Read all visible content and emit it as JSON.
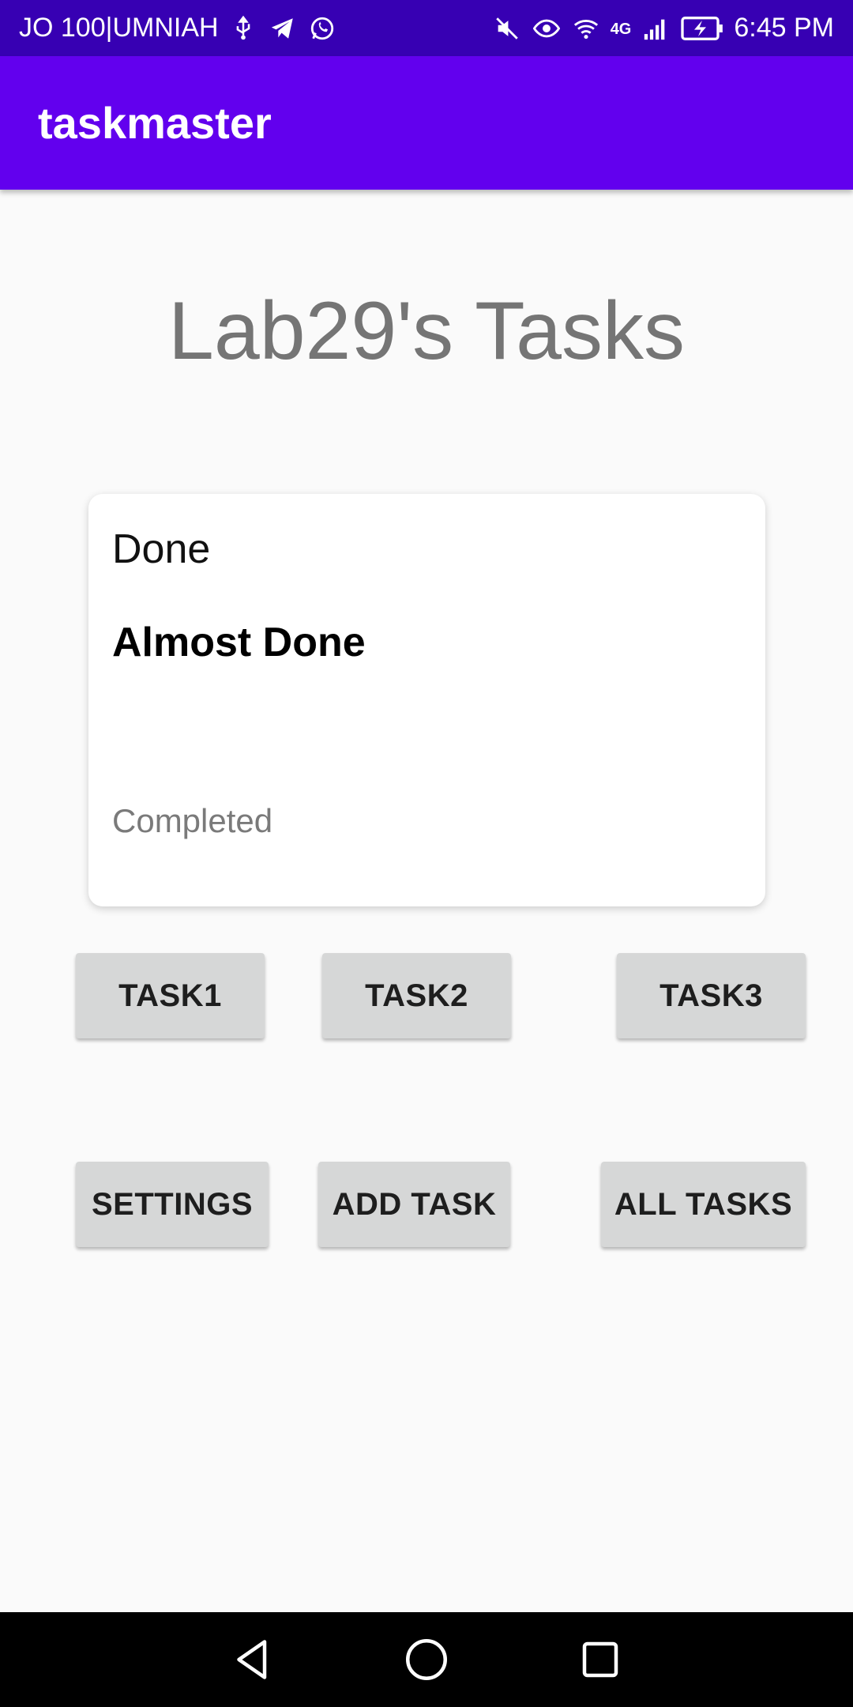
{
  "status_bar": {
    "carrier": "JO 100|UMNIAH",
    "network": "4G",
    "time": "6:45 PM",
    "icons_left": [
      "usb-icon",
      "telegram-icon",
      "whatsapp-icon"
    ],
    "icons_right": [
      "mute-icon",
      "eye-icon",
      "wifi-icon",
      "signal-icon",
      "battery-icon"
    ]
  },
  "app_bar": {
    "title": "taskmaster"
  },
  "page": {
    "title": "Lab29's Tasks"
  },
  "card": {
    "state": "Done",
    "title": "Almost Done",
    "footer": "Completed"
  },
  "buttons": {
    "task1": "TASK1",
    "task2": "TASK2",
    "task3": "TASK3",
    "settings": "SETTINGS",
    "add_task": "ADD TASK",
    "all_tasks": "ALL TASKS"
  },
  "colors": {
    "status_bar": "#3700b3",
    "app_bar": "#6200ee",
    "button": "#d6d7d7"
  },
  "nav": {
    "icons": [
      "back-icon",
      "home-icon",
      "recents-icon"
    ]
  }
}
